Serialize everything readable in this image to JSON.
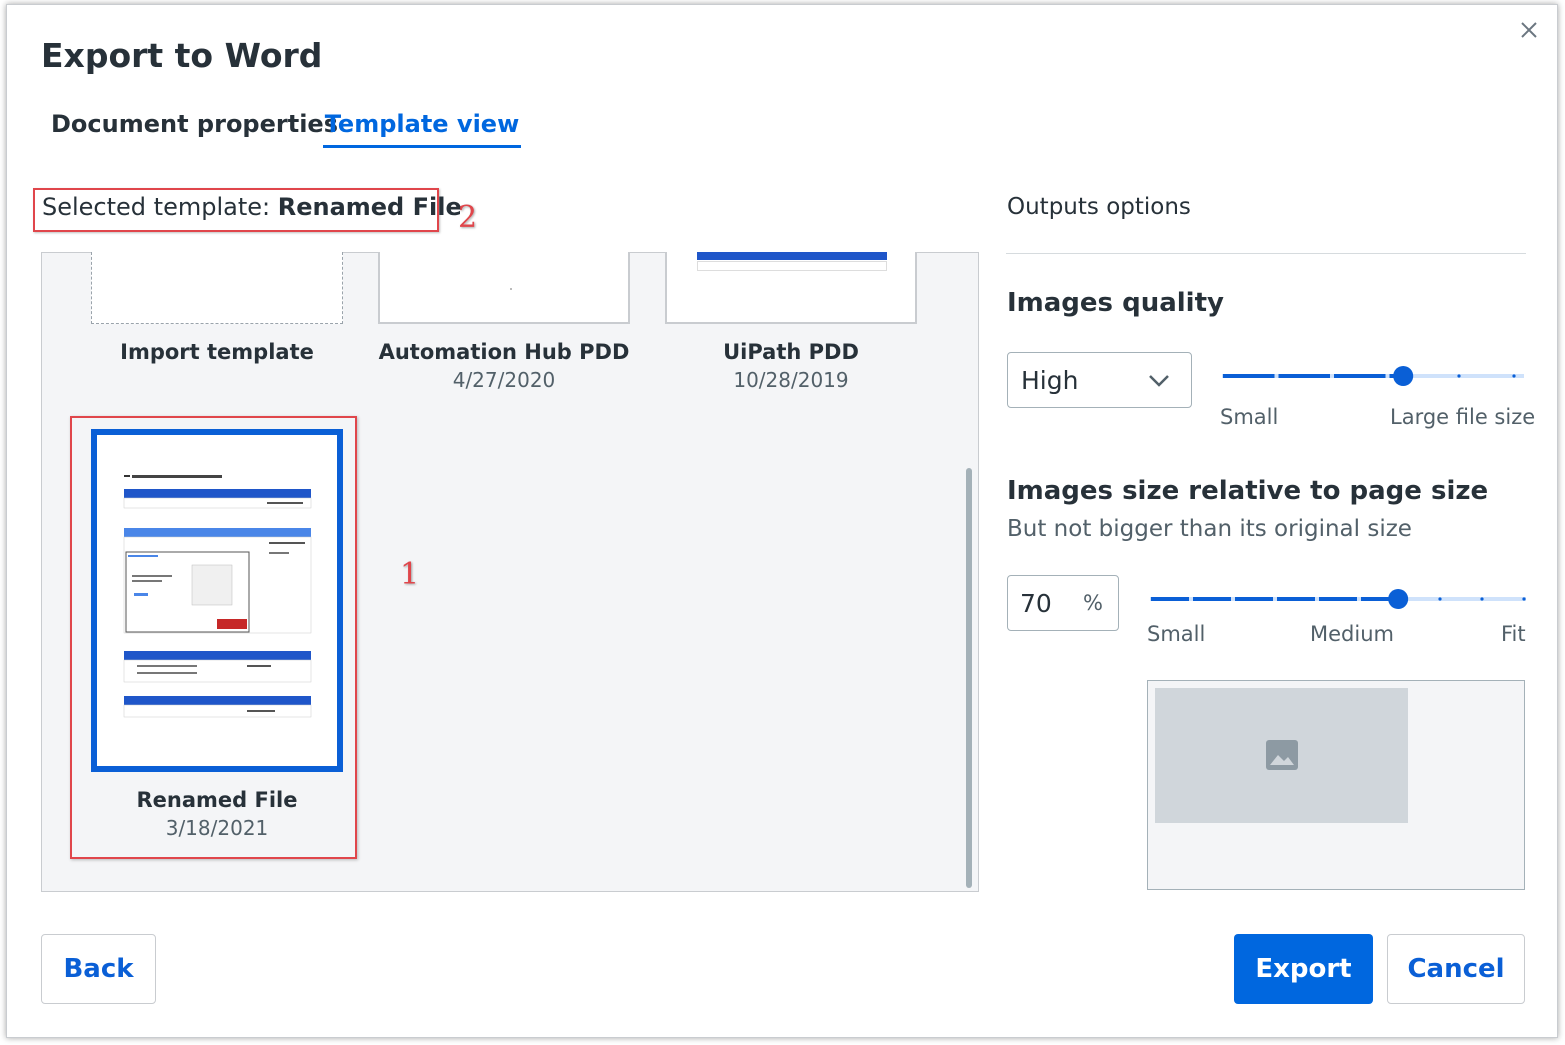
{
  "dialog": {
    "title": "Export to Word",
    "close_icon": "close-icon"
  },
  "tabs": [
    {
      "label": "Document properties",
      "active": false
    },
    {
      "label": "Template view",
      "active": true
    }
  ],
  "selected_template": {
    "label": "Selected template:",
    "value": "Renamed File"
  },
  "annotations": {
    "step1": "1",
    "step2": "2"
  },
  "templates": [
    {
      "name": "Import template",
      "date": ""
    },
    {
      "name": "Automation Hub PDD",
      "date": "4/27/2020"
    },
    {
      "name": "UiPath PDD",
      "date": "10/28/2019"
    },
    {
      "name": "Renamed File",
      "date": "3/18/2021",
      "selected": true
    }
  ],
  "outputs": {
    "title": "Outputs options",
    "images_quality": {
      "heading": "Images quality",
      "selected": "High",
      "slider_min_label": "Small",
      "slider_max_label": "Large file size",
      "level_percent": 60
    },
    "images_size": {
      "heading": "Images size relative to page size",
      "subtext": "But not bigger than its original size",
      "value": "70",
      "unit": "%",
      "slider_labels": [
        "Small",
        "Medium",
        "Fit"
      ],
      "level_percent": 66
    },
    "preview_icon": "image-icon"
  },
  "buttons": {
    "back": "Back",
    "export": "Export",
    "cancel": "Cancel"
  },
  "colors": {
    "accent": "#0067df",
    "highlight": "#e0464b",
    "thumb_border": "#0a5fd6"
  }
}
